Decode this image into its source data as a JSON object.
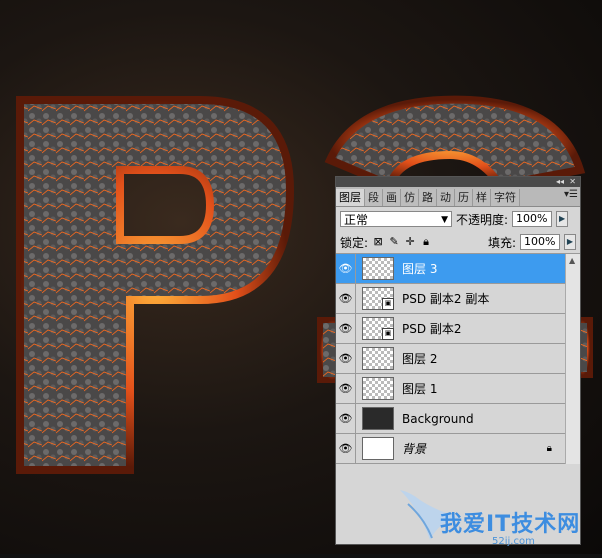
{
  "panel": {
    "tabs": [
      "图层",
      "段",
      "画",
      "仿",
      "路",
      "动",
      "历",
      "样",
      "字符"
    ],
    "blend_mode": "正常",
    "opacity_label": "不透明度:",
    "opacity_value": "100%",
    "lock_label": "锁定:",
    "fill_label": "填充:",
    "fill_value": "100%"
  },
  "layers": [
    {
      "name": "图层 3",
      "selected": true
    },
    {
      "name": "PSD 副本2 副本"
    },
    {
      "name": "PSD 副本2"
    },
    {
      "name": "图层 2"
    },
    {
      "name": "图层 1"
    },
    {
      "name": "Background"
    },
    {
      "name": "背景",
      "locked": true
    }
  ],
  "watermark": {
    "text": "我爱IT技术网",
    "url": "52ij.com"
  },
  "colors": {
    "selected_row": "#3d9bef",
    "lava": "#ff7a1a"
  }
}
